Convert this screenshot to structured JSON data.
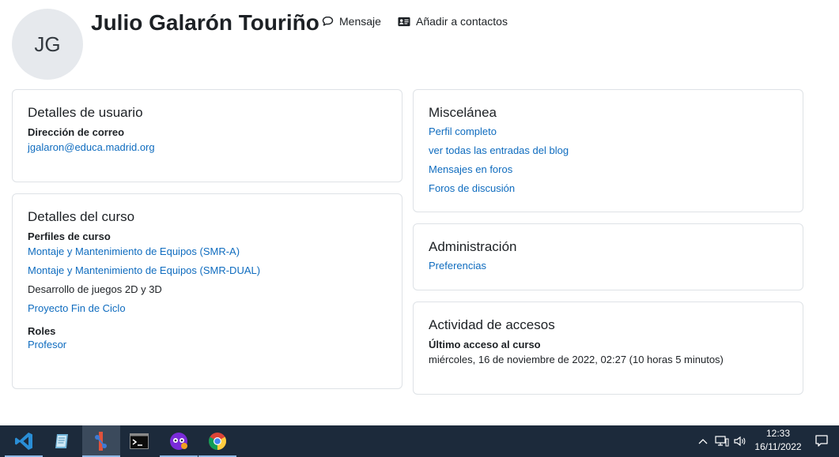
{
  "profile": {
    "initials": "JG",
    "name": "Julio Galarón Touriño",
    "actions": {
      "message": "Mensaje",
      "add_contact": "Añadir a contactos"
    }
  },
  "user_details": {
    "title": "Detalles de usuario",
    "email_label": "Dirección de correo",
    "email": "jgalaron@educa.madrid.org"
  },
  "course_details": {
    "title": "Detalles del curso",
    "profiles_label": "Perfiles de curso",
    "courses": [
      "Montaje y Mantenimiento de Equipos (SMR-A)",
      "Montaje y Mantenimiento de Equipos (SMR-DUAL)",
      "Desarrollo de juegos 2D y 3D",
      "Proyecto Fin de Ciclo"
    ],
    "roles_label": "Roles",
    "role": "Profesor"
  },
  "misc": {
    "title": "Miscelánea",
    "links": [
      "Perfil completo",
      "ver todas las entradas del blog",
      "Mensajes en foros",
      "Foros de discusión"
    ]
  },
  "admin": {
    "title": "Administración",
    "link": "Preferencias"
  },
  "access": {
    "title": "Actividad de accesos",
    "last_access_label": "Último acceso al curso",
    "last_access_value": "miércoles, 16 de noviembre de 2022, 02:27  (10 horas 5 minutos)"
  },
  "taskbar": {
    "apps": [
      "vscode-icon",
      "notepad-icon",
      "git-client-icon",
      "terminal-icon",
      "purple-app-icon",
      "chrome-icon"
    ],
    "time": "12:33",
    "date": "16/11/2022"
  },
  "colors": {
    "link": "#0f6cbf",
    "taskbar": "#1c2a3b",
    "avatar_bg": "#e6e9ed"
  }
}
